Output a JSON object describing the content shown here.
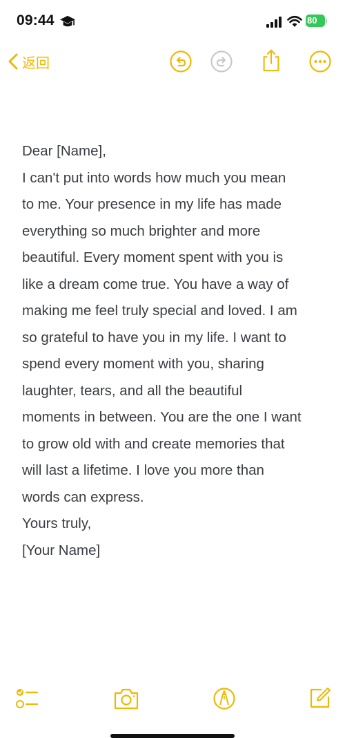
{
  "status_bar": {
    "time": "09:44",
    "battery_level": "80"
  },
  "toolbar": {
    "back_label": "返回"
  },
  "note": {
    "lines": [
      "Dear [Name],",
      "I can't put into words how much you mean",
      "to me. Your presence in my life has made",
      "everything so much brighter and more",
      "beautiful. Every moment spent with you is",
      "like a dream come true. You have a way of",
      "making me feel truly special and loved. I am",
      "so grateful to have you in my life. I want to",
      "spend every moment with you, sharing",
      "laughter, tears, and all the beautiful",
      "moments in between. You are the one I want",
      "to grow old with and create memories that",
      "will last a lifetime. I love you more than",
      "words can express.",
      "Yours truly,",
      "[Your Name]"
    ]
  },
  "icons": {
    "status": [
      "graduation-cap-icon",
      "signal-icon",
      "wifi-icon",
      "battery-icon"
    ],
    "top_toolbar": [
      "chevron-left-icon",
      "undo-icon",
      "redo-icon",
      "share-icon",
      "more-icon"
    ],
    "bottom_toolbar": [
      "checklist-icon",
      "camera-icon",
      "markup-icon",
      "compose-icon"
    ]
  },
  "colors": {
    "accent": "#f0b800",
    "text": "#3a3d42",
    "battery": "#34c759",
    "disabled_icon": "#c8c8cc"
  }
}
